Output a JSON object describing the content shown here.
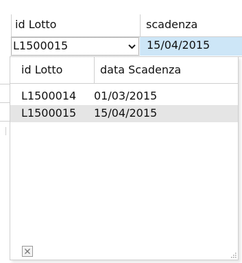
{
  "grid": {
    "columns": [
      {
        "label": "id Lotto"
      },
      {
        "label": "scadenza"
      }
    ],
    "current_row": {
      "id_lotto": "L1500015",
      "scadenza": "15/04/2015"
    }
  },
  "dropdown": {
    "columns": [
      {
        "label": "id Lotto"
      },
      {
        "label": "data Scadenza"
      }
    ],
    "rows": [
      {
        "id_lotto": "L1500014",
        "data_scadenza": "01/03/2015"
      },
      {
        "id_lotto": "L1500015",
        "data_scadenza": "15/04/2015"
      }
    ],
    "selected_index": 1
  },
  "icons": {
    "combo_arrow": "chevron-down-icon",
    "close": "close-icon",
    "resize": "resize-grip-icon"
  },
  "colors": {
    "selection_blue": "#cde6f7",
    "hover_gray": "#e5e5e5",
    "grid_line": "#cfcfcf"
  }
}
